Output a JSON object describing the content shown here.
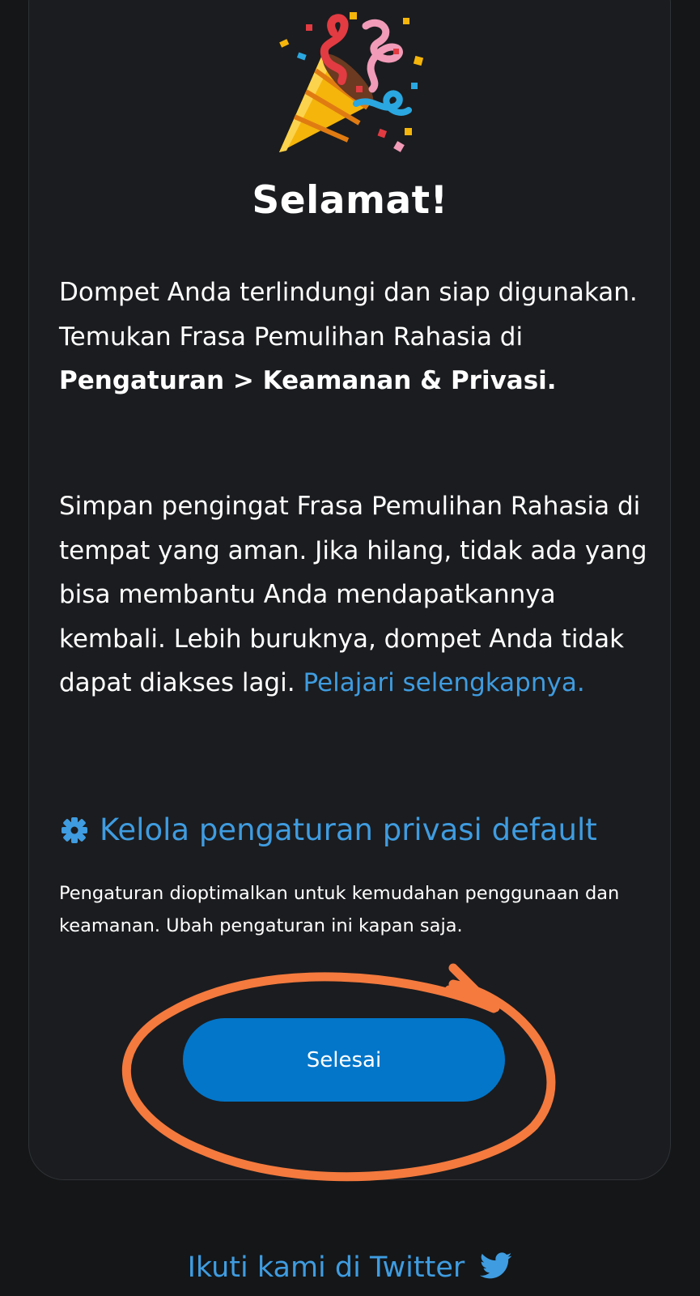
{
  "header": {
    "emoji": "party-popper-icon",
    "title": "Selamat!"
  },
  "message": {
    "p1_text": "Dompet Anda terlindungi dan siap digunakan. Temukan Frasa Pemulihan Rahasia di ",
    "p1_bold": "Pengaturan > Keamanan & Privasi.",
    "p2_text": "Simpan pengingat Frasa Pemulihan Rahasia di tempat yang aman. Jika hilang, tidak ada yang bisa membantu Anda mendapatkannya kembali. Lebih buruknya, dompet Anda tidak dapat diakses lagi. ",
    "p2_link": "Pelajari selengkapnya."
  },
  "privacy": {
    "icon": "gear-icon",
    "link_label": "Kelola pengaturan privasi default",
    "note": "Pengaturan dioptimalkan untuk kemudahan penggunaan dan keamanan. Ubah pengaturan ini kapan saja."
  },
  "actions": {
    "done_label": "Selesai"
  },
  "footer": {
    "twitter_label": "Ikuti kami di Twitter",
    "twitter_icon": "twitter-bird-icon"
  },
  "colors": {
    "background": "#141618",
    "card": "#1b1c1f",
    "link": "#3f9ce0",
    "button": "#0376c9",
    "annotation": "#f47a3e"
  }
}
